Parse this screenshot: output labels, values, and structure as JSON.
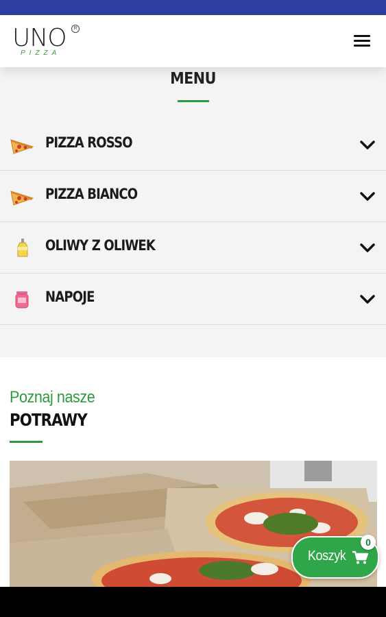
{
  "header": {
    "logo_main": "UNO",
    "logo_sub": "PIZZA",
    "logo_reg": "R"
  },
  "menu": {
    "title": "MENU",
    "categories": [
      {
        "label": "PIZZA ROSSO",
        "icon": "pizza-slice-icon"
      },
      {
        "label": "PIZZA BIANCO",
        "icon": "pizza-slice-icon"
      },
      {
        "label": "OLIWY Z OLIWEK",
        "icon": "oil-bottle-icon"
      },
      {
        "label": "NAPOJE",
        "icon": "drink-jar-icon"
      }
    ]
  },
  "potrawy": {
    "subtitle": "Poznaj nasze",
    "title": "POTRAWY"
  },
  "cart": {
    "label": "Koszyk",
    "count": "0"
  },
  "colors": {
    "status_bar": "#2e3d9e",
    "accent_green": "#2e9a3e",
    "menu_bg": "#f4f4f4"
  }
}
